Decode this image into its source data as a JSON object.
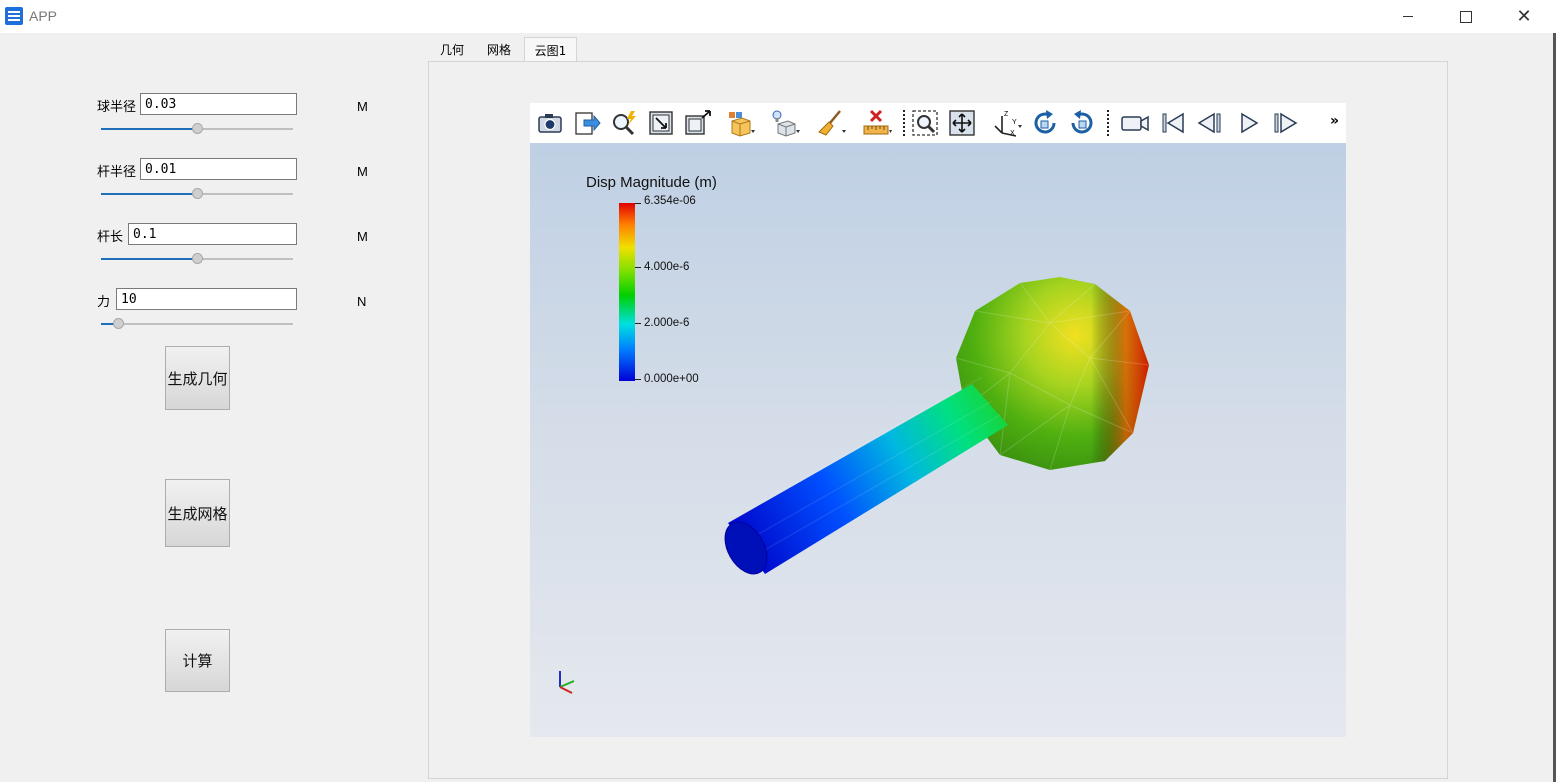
{
  "window": {
    "title": "APP",
    "minimize": "—",
    "maximize": "☐",
    "close": "✕"
  },
  "params": [
    {
      "label": "球半径",
      "value": "0.03",
      "unit": "M",
      "slider": 0.5
    },
    {
      "label": "杆半径",
      "value": "0.01",
      "unit": "M",
      "slider": 0.5
    },
    {
      "label": "杆长",
      "value": "0.1",
      "unit": "M",
      "slider": 0.5
    },
    {
      "label": "力",
      "value": "10",
      "unit": "N",
      "slider": 0.09
    }
  ],
  "buttons": {
    "geometry": "生成几何",
    "mesh": "生成网格",
    "compute": "计算"
  },
  "tabs": [
    "几何",
    "网格",
    "云图1"
  ],
  "active_tab": "云图1",
  "toolbar": {
    "more": "»",
    "icons": [
      "camera-icon",
      "export-icon",
      "magic-lightning-icon",
      "reset-camera-icon",
      "zoom-to-box-icon",
      "representation-cube-icon",
      "lighting-icon",
      "clear-brush-icon",
      "delete-ruler-icon",
      "zoom-select-icon",
      "pan-icon",
      "axes-icon",
      "rotate-cw-icon",
      "rotate-ccw-icon",
      "record-camera-icon",
      "first-frame-icon",
      "previous-frame-icon",
      "play-icon",
      "next-frame-icon"
    ]
  },
  "colorbar": {
    "title": "Disp Magnitude (m)",
    "max_label": "6.354e-06",
    "labels": [
      "4.000e-6",
      "2.000e-6",
      "0.000e+00"
    ],
    "colors": [
      "#0000d8",
      "#0080ff",
      "#00e0e0",
      "#00d000",
      "#80e000",
      "#f0e000",
      "#ff8000",
      "#e00000"
    ]
  }
}
